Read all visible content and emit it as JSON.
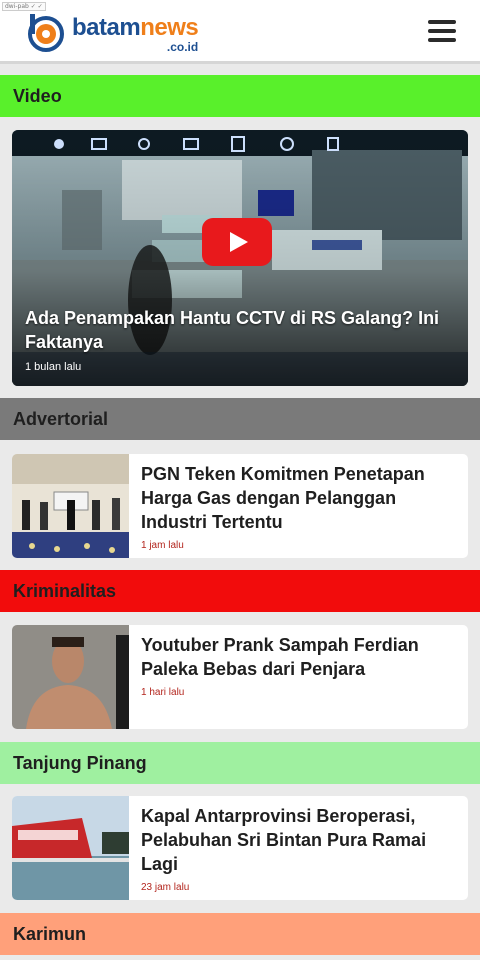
{
  "header": {
    "tiny_tag": "dwi-pab ✓ ✓",
    "logo_main_a": "batam",
    "logo_main_b": "news",
    "logo_sub": ".co.id"
  },
  "colors": {
    "video": "#59f02b",
    "advertorial": "#7a7a7a",
    "kriminalitas": "#f20c0c",
    "tanjung_pinang": "#9ff0a0",
    "karimun": "#ffa07a",
    "brand_blue": "#1d4f91",
    "brand_orange": "#ef7f1a"
  },
  "categories": {
    "video": "Video",
    "advertorial": "Advertorial",
    "kriminalitas": "Kriminalitas",
    "tanjung_pinang": "Tanjung Pinang",
    "karimun": "Karimun"
  },
  "video": {
    "title": "Ada Penampakan Hantu CCTV di RS Galang? Ini Faktanya",
    "time": "1 bulan lalu",
    "play_icon": "play-icon"
  },
  "articles": [
    {
      "title": "PGN Teken Komitmen Penetapan Harga Gas dengan Pelanggan Industri Tertentu",
      "time": "1 jam lalu"
    },
    {
      "title": "Youtuber Prank Sampah Ferdian Paleka Bebas dari Penjara",
      "time": "1 hari lalu"
    },
    {
      "title": "Kapal Antarprovinsi Beroperasi, Pelabuhan Sri Bintan Pura Ramai Lagi",
      "time": "23 jam lalu"
    }
  ]
}
